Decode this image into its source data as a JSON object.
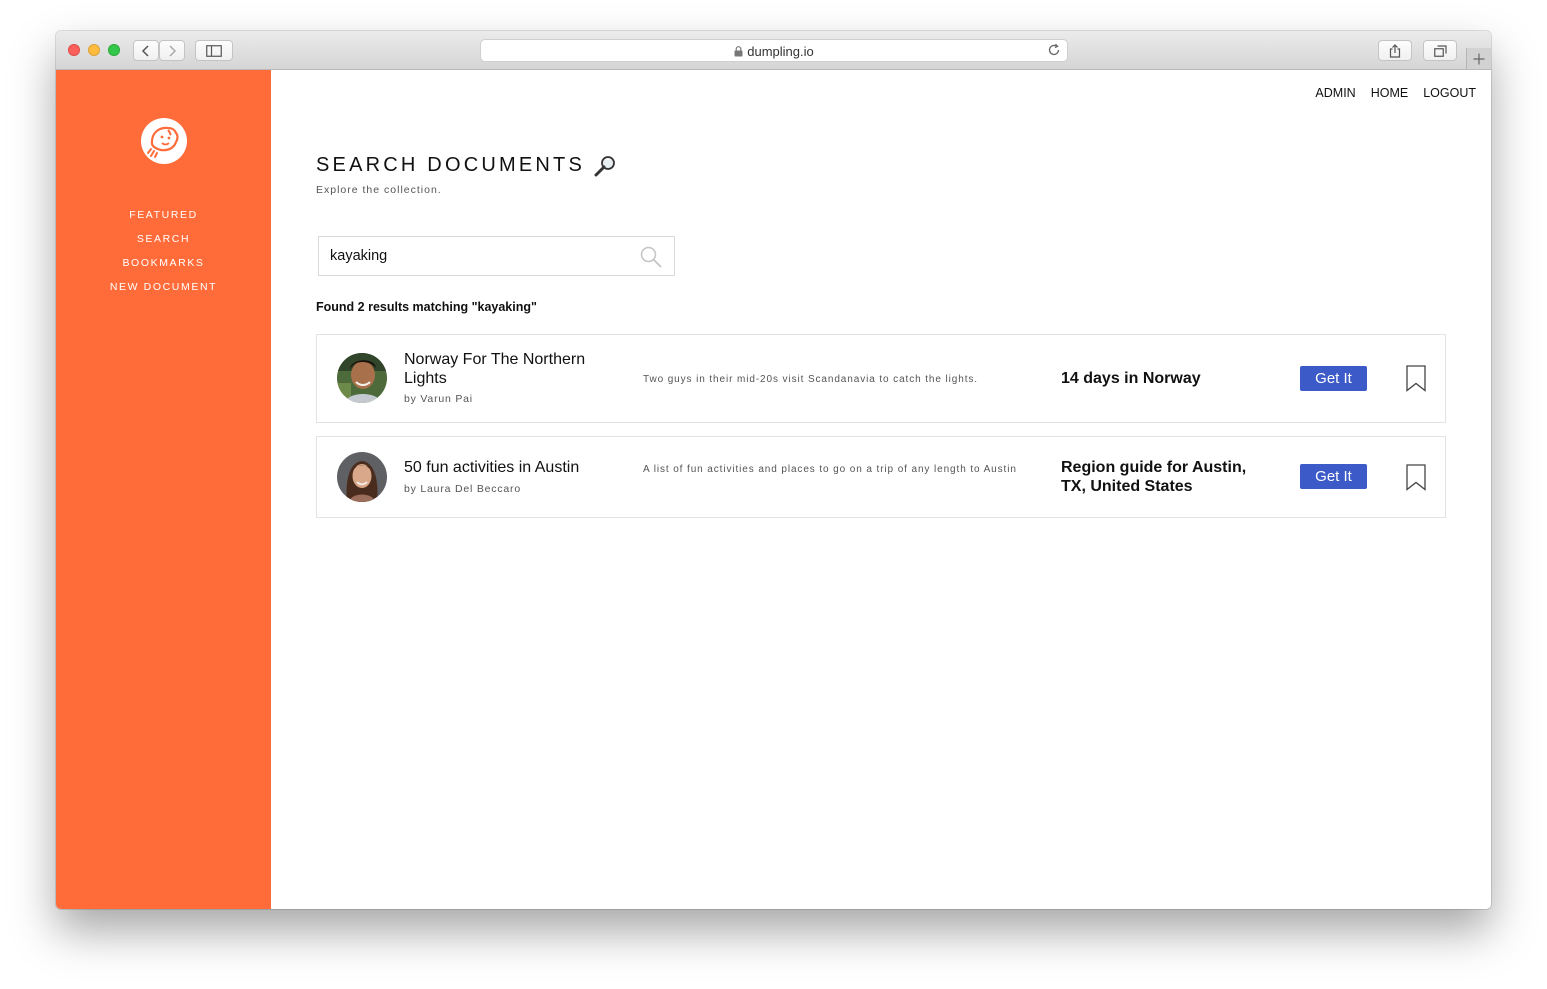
{
  "browser": {
    "url": "dumpling.io"
  },
  "colors": {
    "sidebar": "#ff6c3a",
    "button": "#3c5ac8"
  },
  "sidebar": {
    "items": [
      {
        "label": "FEATURED"
      },
      {
        "label": "SEARCH"
      },
      {
        "label": "BOOKMARKS"
      },
      {
        "label": "NEW DOCUMENT"
      }
    ]
  },
  "topnav": {
    "items": [
      {
        "label": "ADMIN"
      },
      {
        "label": "HOME"
      },
      {
        "label": "LOGOUT"
      }
    ]
  },
  "page": {
    "title": "SEARCH DOCUMENTS",
    "title_icon": "magnifier-icon",
    "subtitle": "Explore the collection."
  },
  "search": {
    "value": "kayaking",
    "result_text": "Found 2 results matching \"kayaking\""
  },
  "results": [
    {
      "title": "Norway For The Northern Lights",
      "author": "by Varun Pai",
      "description": "Two guys in their mid-20s visit Scandanavia to catch the lights.",
      "guide": "14 days in Norway",
      "button_label": "Get It"
    },
    {
      "title": "50 fun activities in Austin",
      "author": "by Laura Del Beccaro",
      "description": "A list of fun activities and places to go on a trip of any length to Austin",
      "guide": "Region guide for Austin, TX, United States",
      "button_label": "Get It"
    }
  ]
}
